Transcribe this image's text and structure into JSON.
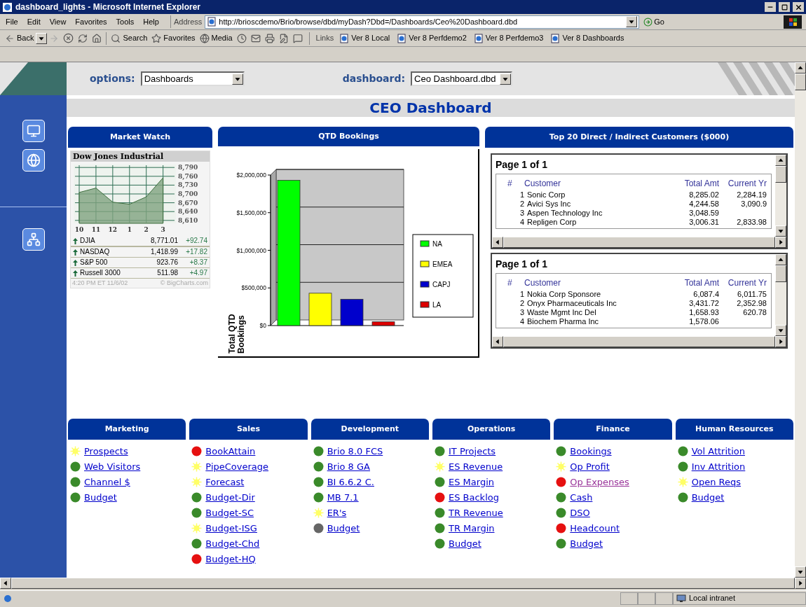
{
  "window": {
    "title": "dashboard_lights - Microsoft Internet Explorer"
  },
  "menu": [
    "File",
    "Edit",
    "View",
    "Favorites",
    "Tools",
    "Help"
  ],
  "address": {
    "label": "Address",
    "url": "http://brioscdemo/Brio/browse/dbd/myDash?Dbd=/Dashboards/Ceo%20Dashboard.dbd",
    "go": "Go"
  },
  "toolbar": {
    "back": "Back",
    "search": "Search",
    "favorites": "Favorites",
    "media": "Media",
    "links_label": "Links",
    "links": [
      "Ver 8 Local",
      "Ver 8 Perfdemo2",
      "Ver 8 Perfdemo3",
      "Ver 8 Dashboards"
    ]
  },
  "options_bar": {
    "options_label": "options:",
    "options_value": "Dashboards",
    "dashboard_label": "dashboard:",
    "dashboard_value": "Ceo Dashboard.dbd"
  },
  "page_title": "CEO Dashboard",
  "market_watch": {
    "title": "Market Watch",
    "chart_data": {
      "type": "area",
      "title": "Dow Jones Industrial",
      "grid": true,
      "categories": [
        "10",
        "11",
        "12",
        "1",
        "2",
        "3"
      ],
      "series": [
        {
          "color": "#7fa37f",
          "values": [
            8705,
            8720,
            8672,
            8665,
            8690,
            8755
          ]
        }
      ],
      "ylim": [
        8600,
        8800
      ],
      "yticks": [
        {
          "value": 8790,
          "label": "8,790"
        },
        {
          "value": 8760,
          "label": "8,760"
        },
        {
          "value": 8730,
          "label": "8,730"
        },
        {
          "value": 8700,
          "label": "8,700"
        },
        {
          "value": 8670,
          "label": "8,670"
        },
        {
          "value": 8640,
          "label": "8,640"
        },
        {
          "value": 8610,
          "label": "8,610"
        }
      ]
    },
    "indices": [
      {
        "name": "DJIA",
        "value": "8,771.01",
        "change": "+92.74",
        "rising": true
      },
      {
        "name": "NASDAQ",
        "value": "1,418.99",
        "change": "+17.82",
        "rising": true
      },
      {
        "name": "S&P 500",
        "value": "923.76",
        "change": "+8.37",
        "rising": true
      },
      {
        "name": "Russell 3000",
        "value": "511.98",
        "change": "+4.97",
        "rising": true
      }
    ],
    "timestamp": "4:20 PM ET 11/6/02",
    "credit": "© BigCharts.com"
  },
  "bookings": {
    "title": "QTD Bookings",
    "chart_data": {
      "type": "bar",
      "ylabel": "Total QTD Bookings",
      "ylim": [
        0,
        2000000
      ],
      "grid": true,
      "legend": true,
      "yticks": [
        {
          "value": 0,
          "label": "$0"
        },
        {
          "value": 500000,
          "label": "$500,000"
        },
        {
          "value": 1000000,
          "label": "$1,000,000"
        },
        {
          "value": 1500000,
          "label": "$1,500,000"
        },
        {
          "value": 2000000,
          "label": "$2,000,000"
        }
      ],
      "series": [
        {
          "name": "NA",
          "color": "#00ff00",
          "values": [
            1930000
          ]
        },
        {
          "name": "EMEA",
          "color": "#ffff00",
          "values": [
            430000
          ]
        },
        {
          "name": "CAPJ",
          "color": "#0000cc",
          "values": [
            350000
          ]
        },
        {
          "name": "LA",
          "color": "#dd0000",
          "values": [
            50000
          ]
        }
      ]
    }
  },
  "customers": {
    "title": "Top 20 Direct / Indirect Customers ($000)",
    "tables": [
      {
        "page": "Page 1 of 1",
        "columns": [
          "#",
          "Customer",
          "Total Amt",
          "Current Yr"
        ],
        "rows": [
          [
            "1",
            "Sonic Corp",
            "8,285.02",
            "2,284.19"
          ],
          [
            "2",
            "Avici Sys Inc",
            "4,244.58",
            "3,090.9"
          ],
          [
            "3",
            "Aspen Technology Inc",
            "3,048.59",
            null
          ],
          [
            "4",
            "Repligen Corp",
            "3,006.31",
            "2,833.98"
          ]
        ]
      },
      {
        "page": "Page 1 of 1",
        "columns": [
          "#",
          "Customer",
          "Total Amt",
          "Current Yr"
        ],
        "rows": [
          [
            "1",
            "Nokia Corp Sponsore",
            "6,087.4",
            "6,011.75"
          ],
          [
            "2",
            "Onyx Pharmaceuticals Inc",
            "3,431.72",
            "2,352.98"
          ],
          [
            "3",
            "Waste Mgmt Inc Del",
            "1,658.93",
            "620.78"
          ],
          [
            "4",
            "Biochem Pharma Inc",
            "1,578.06",
            null
          ]
        ]
      }
    ]
  },
  "categories": [
    {
      "title": "Marketing",
      "items": [
        {
          "label": "Prospects",
          "kind": "sun",
          "color": "#ffff66",
          "visited": false
        },
        {
          "label": "Web Visitors",
          "kind": "dot",
          "color": "#3a8a2a",
          "visited": false
        },
        {
          "label": "Channel $",
          "kind": "dot",
          "color": "#3a8a2a",
          "visited": false
        },
        {
          "label": "Budget",
          "kind": "dot",
          "color": "#3a8a2a",
          "visited": false
        }
      ]
    },
    {
      "title": "Sales",
      "items": [
        {
          "label": "BookAttain",
          "kind": "dot",
          "color": "#e61010",
          "visited": false
        },
        {
          "label": "PipeCoverage",
          "kind": "sun",
          "color": "#ffff66",
          "visited": false
        },
        {
          "label": "Forecast",
          "kind": "sun",
          "color": "#ffff66",
          "visited": false
        },
        {
          "label": "Budget-Dir",
          "kind": "dot",
          "color": "#3a8a2a",
          "visited": false
        },
        {
          "label": "Budget-SC",
          "kind": "dot",
          "color": "#3a8a2a",
          "visited": false
        },
        {
          "label": "Budget-ISG",
          "kind": "sun",
          "color": "#ffff66",
          "visited": false
        },
        {
          "label": "Budget-Chd",
          "kind": "dot",
          "color": "#3a8a2a",
          "visited": false
        },
        {
          "label": "Budget-HQ",
          "kind": "dot",
          "color": "#e61010",
          "visited": false
        }
      ]
    },
    {
      "title": "Development",
      "items": [
        {
          "label": "Brio 8.0 FCS",
          "kind": "dot",
          "color": "#3a8a2a",
          "visited": false
        },
        {
          "label": "Brio 8 GA",
          "kind": "dot",
          "color": "#3a8a2a",
          "visited": false
        },
        {
          "label": "BI 6.6.2 C.",
          "kind": "dot",
          "color": "#3a8a2a",
          "visited": false
        },
        {
          "label": "MB 7.1",
          "kind": "dot",
          "color": "#3a8a2a",
          "visited": false
        },
        {
          "label": "ER's",
          "kind": "sun",
          "color": "#ffff66",
          "visited": false
        },
        {
          "label": "Budget",
          "kind": "dot",
          "color": "#666666",
          "visited": false
        }
      ]
    },
    {
      "title": "Operations",
      "items": [
        {
          "label": "IT Projects",
          "kind": "dot",
          "color": "#3a8a2a",
          "visited": false
        },
        {
          "label": "ES Revenue",
          "kind": "sun",
          "color": "#ffff66",
          "visited": false
        },
        {
          "label": "ES Margin",
          "kind": "dot",
          "color": "#3a8a2a",
          "visited": false
        },
        {
          "label": "ES Backlog",
          "kind": "dot",
          "color": "#e61010",
          "visited": false
        },
        {
          "label": "TR Revenue",
          "kind": "dot",
          "color": "#3a8a2a",
          "visited": false
        },
        {
          "label": "TR Margin",
          "kind": "dot",
          "color": "#3a8a2a",
          "visited": false
        },
        {
          "label": "Budget",
          "kind": "dot",
          "color": "#3a8a2a",
          "visited": false
        }
      ]
    },
    {
      "title": "Finance",
      "items": [
        {
          "label": "Bookings",
          "kind": "dot",
          "color": "#3a8a2a",
          "visited": false
        },
        {
          "label": "Op Profit",
          "kind": "sun",
          "color": "#ffff66",
          "visited": false
        },
        {
          "label": "Op Expenses",
          "kind": "dot",
          "color": "#e61010",
          "visited": true
        },
        {
          "label": "Cash",
          "kind": "dot",
          "color": "#3a8a2a",
          "visited": false
        },
        {
          "label": "DSO",
          "kind": "dot",
          "color": "#3a8a2a",
          "visited": false
        },
        {
          "label": "Headcount",
          "kind": "dot",
          "color": "#e61010",
          "visited": false
        },
        {
          "label": "Budget",
          "kind": "dot",
          "color": "#3a8a2a",
          "visited": false
        }
      ]
    },
    {
      "title": "Human Resources",
      "items": [
        {
          "label": "Vol Attrition",
          "kind": "dot",
          "color": "#3a8a2a",
          "visited": false
        },
        {
          "label": "Inv Attrition",
          "kind": "dot",
          "color": "#3a8a2a",
          "visited": false
        },
        {
          "label": "Open Reqs",
          "kind": "sun",
          "color": "#ffff66",
          "visited": false
        },
        {
          "label": "Budget",
          "kind": "dot",
          "color": "#3a8a2a",
          "visited": false
        }
      ]
    }
  ],
  "status_bar": {
    "zone": "Local intranet"
  }
}
